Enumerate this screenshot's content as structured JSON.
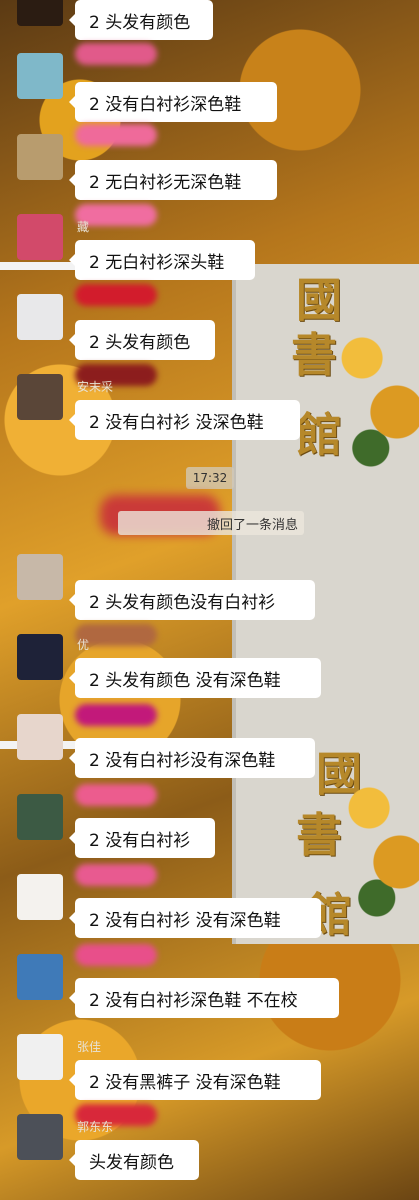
{
  "messages": [
    {
      "text": "2 头发有颜色",
      "name": "",
      "avatar_icon": "avatar-icon",
      "avatar_bg": "#2b1c12",
      "smudge": ""
    },
    {
      "text": "2 没有白衬衫深色鞋",
      "name": "",
      "avatar_icon": "avatar-icon",
      "avatar_bg": "#7fb8c9",
      "smudge": "#e15a8a"
    },
    {
      "text": "2 无白衬衫无深色鞋",
      "name": "",
      "avatar_icon": "avatar-icon",
      "avatar_bg": "#b89c6e",
      "smudge": "#ef6a9a"
    },
    {
      "text": "2 无白衬衫深头鞋",
      "name": "藏",
      "avatar_icon": "avatar-icon",
      "avatar_bg": "#d24a6a",
      "smudge": "#f06da0"
    },
    {
      "text": "2 头发有颜色",
      "name": "",
      "avatar_icon": "avatar-icon",
      "avatar_bg": "#e8e8ea",
      "smudge": "#d21c2c"
    },
    {
      "text": "2 没有白衬衫 没深色鞋",
      "name": "安末采",
      "avatar_icon": "avatar-icon",
      "avatar_bg": "#5a4638",
      "smudge": "#8c1d1d"
    },
    {
      "text": "2 头发有颜色没有白衬衫",
      "name": "",
      "avatar_icon": "avatar-icon",
      "avatar_bg": "#c7b8a8",
      "smudge": ""
    },
    {
      "text": "2 头发有颜色 没有深色鞋",
      "name": "优",
      "avatar_icon": "avatar-icon",
      "avatar_bg": "#1e2238",
      "smudge": "#b06840"
    },
    {
      "text": "2 没有白衬衫没有深色鞋",
      "name": "",
      "avatar_icon": "avatar-icon",
      "avatar_bg": "#e7d6cc",
      "smudge": "#c2197a"
    },
    {
      "text": "2 没有白衬衫",
      "name": "",
      "avatar_icon": "avatar-icon",
      "avatar_bg": "#3c5a44",
      "smudge": "#ec5c8e"
    },
    {
      "text": "2 没有白衬衫 没有深色鞋",
      "name": "",
      "avatar_icon": "avatar-icon",
      "avatar_bg": "#f4f2ee",
      "smudge": "#e85a90"
    },
    {
      "text": "2 没有白衬衫深色鞋 不在校",
      "name": "",
      "avatar_icon": "avatar-icon",
      "avatar_bg": "#3f7ab8",
      "smudge": "#e84f8a"
    },
    {
      "text": "2 没有黑裤子 没有深色鞋",
      "name": "张佳",
      "avatar_icon": "avatar-icon",
      "avatar_bg": "#f0f0f0",
      "smudge": ""
    },
    {
      "text": "头发有颜色",
      "name": "郭东东",
      "avatar_icon": "avatar-icon",
      "avatar_bg": "#4c5058",
      "smudge": "#d8283a"
    }
  ],
  "system": {
    "time": "17:32",
    "recall": "撤回了一条消息"
  },
  "background": {
    "sign_chars": [
      "國",
      "書",
      "館"
    ]
  }
}
